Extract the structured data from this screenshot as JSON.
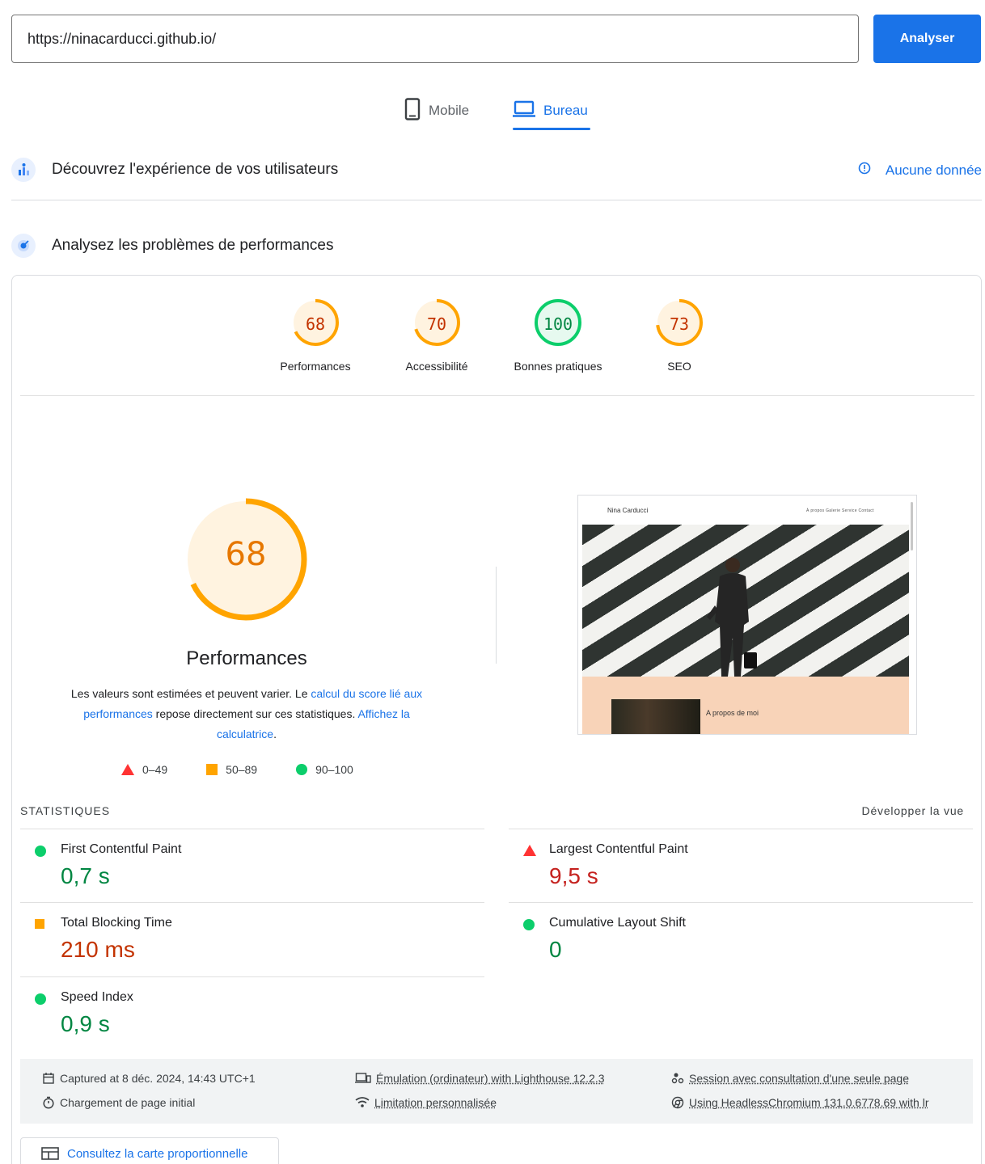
{
  "search": {
    "url_value": "https://ninacarducci.github.io/",
    "analyze_label": "Analyser"
  },
  "device_tabs": [
    {
      "label": "Mobile",
      "icon": "phone-icon",
      "active": false
    },
    {
      "label": "Bureau",
      "icon": "laptop-icon",
      "active": true
    }
  ],
  "field_data": {
    "title": "Découvrez l'expérience de vos utilisateurs",
    "no_data_label": "Aucune donnée"
  },
  "lab_data": {
    "title": "Analysez les problèmes de performances"
  },
  "scores": [
    {
      "value": "68",
      "label": "Performances",
      "score": 68,
      "color": "#ffa400",
      "text_color": "#c33300",
      "bg": "#fff3e0"
    },
    {
      "value": "70",
      "label": "Accessibilité",
      "score": 70,
      "color": "#ffa400",
      "text_color": "#c33300",
      "bg": "#fff3e0"
    },
    {
      "value": "100",
      "label": "Bonnes pratiques",
      "score": 100,
      "color": "#0cce6b",
      "text_color": "#018642",
      "bg": "#e6f9ef"
    },
    {
      "value": "73",
      "label": "SEO",
      "score": 73,
      "color": "#ffa400",
      "text_color": "#c33300",
      "bg": "#fff3e0"
    }
  ],
  "performance": {
    "score": 68,
    "score_text": "68",
    "title": "Performances",
    "desc_1": "Les valeurs sont estimées et peuvent varier. Le ",
    "desc_link_1": "calcul du score lié aux performances",
    "desc_2": " repose directement sur ces statistiques. ",
    "desc_link_2": "Affichez la calculatrice",
    "desc_3": "."
  },
  "legend": [
    {
      "range": "0–49",
      "shape": "triangle"
    },
    {
      "range": "50–89",
      "shape": "square"
    },
    {
      "range": "90–100",
      "shape": "circle"
    }
  ],
  "screenshot": {
    "site_name": "Nina Carducci",
    "nav": "À propos   Galerie   Service   Contact",
    "about": "A propos de moi"
  },
  "stats": {
    "title": "STATISTIQUES",
    "expand_label": "Développer la vue",
    "metrics": [
      {
        "label": "First Contentful Paint",
        "value": "0,7 s",
        "status": "good"
      },
      {
        "label": "Largest Contentful Paint",
        "value": "9,5 s",
        "status": "poor"
      },
      {
        "label": "Total Blocking Time",
        "value": "210 ms",
        "status": "average"
      },
      {
        "label": "Cumulative Layout Shift",
        "value": "0",
        "status": "good"
      },
      {
        "label": "Speed Index",
        "value": "0,9 s",
        "status": "good"
      }
    ]
  },
  "footer": {
    "captured": "Captured at 8 déc. 2024, 14:43 UTC+1",
    "load": "Chargement de page initial",
    "emulation": "Émulation (ordinateur) with Lighthouse 12.2.3",
    "throttling": "Limitation personnalisée",
    "session": "Session avec consultation d'une seule page",
    "browser": "Using HeadlessChromium 131.0.6778.69 with lr"
  },
  "treemap_label": "Consultez la carte proportionnelle",
  "colors": {
    "accent": "#1a73e8",
    "good": "#0cce6b",
    "average": "#ffa400",
    "poor": "#ff3333"
  }
}
